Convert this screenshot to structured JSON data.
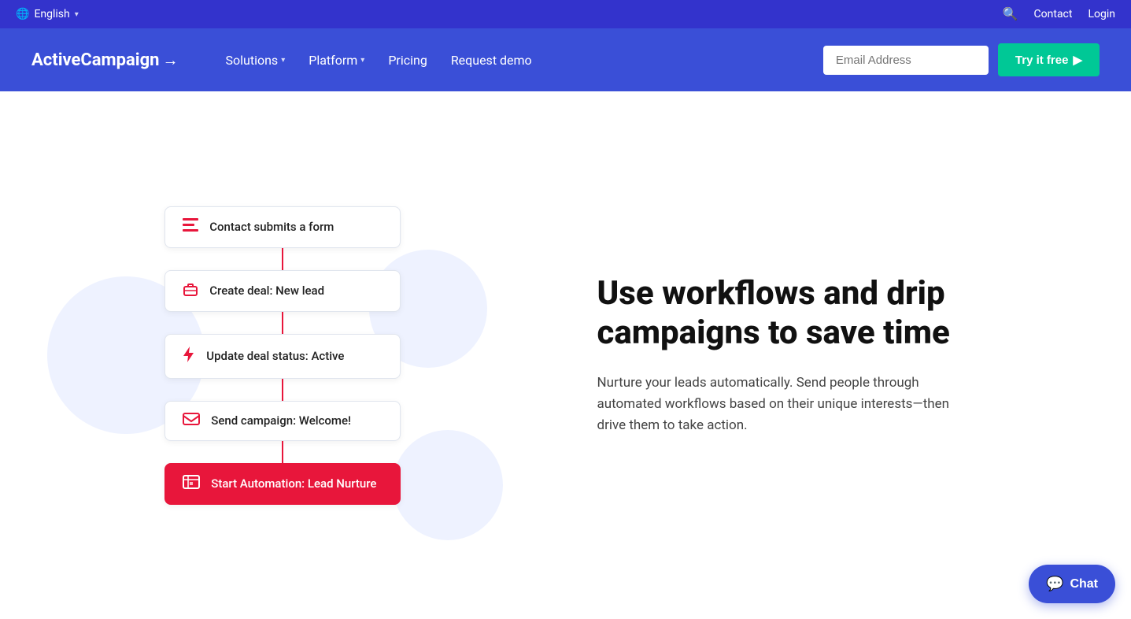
{
  "topbar": {
    "language": "English",
    "contact_label": "Contact",
    "login_label": "Login",
    "search_aria": "Search"
  },
  "nav": {
    "logo": "ActiveCampaign",
    "logo_arrow": "→",
    "links": [
      {
        "label": "Solutions",
        "has_dropdown": true
      },
      {
        "label": "Platform",
        "has_dropdown": true
      },
      {
        "label": "Pricing",
        "has_dropdown": false
      },
      {
        "label": "Request demo",
        "has_dropdown": false
      }
    ],
    "email_placeholder": "Email Address",
    "try_free_label": "Try it free",
    "try_free_arrow": "▶"
  },
  "workflow": {
    "items": [
      {
        "id": "form",
        "label": "Contact submits a form",
        "icon_type": "form",
        "active": false
      },
      {
        "id": "deal",
        "label": "Create deal: New lead",
        "icon_type": "briefcase",
        "active": false
      },
      {
        "id": "status",
        "label": "Update deal status: Active",
        "icon_type": "bolt",
        "active": false
      },
      {
        "id": "campaign",
        "label": "Send campaign: Welcome!",
        "icon_type": "email",
        "active": false
      },
      {
        "id": "automation",
        "label": "Start Automation: Lead Nurture",
        "icon_type": "table",
        "active": true
      }
    ]
  },
  "hero": {
    "headline": "Use workflows and drip campaigns to save time",
    "subtext": "Nurture your leads automatically. Send people through automated workflows based on their unique interests—then drive them to take action."
  },
  "chat": {
    "label": "Chat"
  }
}
